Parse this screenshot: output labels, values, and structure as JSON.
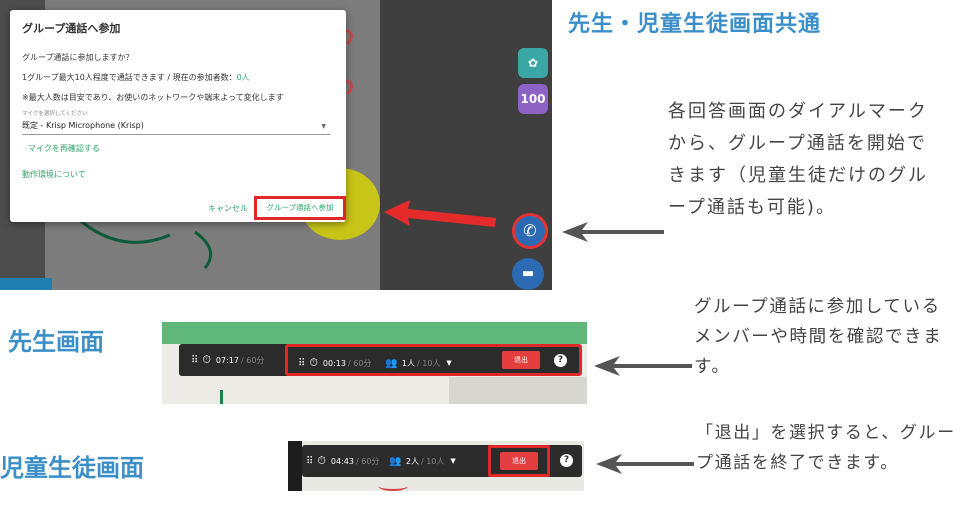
{
  "top": {
    "heading": "先生・児童生徒画面共通",
    "description": "各回答画面のダイアルマークから、グループ通話を開始できます（児童生徒だけのグループ通話も可能)。",
    "side_buttons": [
      {
        "icon": "group-call-icon",
        "label": "",
        "color": "#3aa7a4"
      },
      {
        "icon": "percent-100-icon",
        "label": "100",
        "color": "#8d62c4"
      }
    ],
    "call_fab_icon": "phone-icon",
    "chat_fab_icon": "chat-icon",
    "dialog": {
      "title": "グループ通話へ参加",
      "question": "グループ通話に参加しますか？",
      "limit_prefix": "1グループ最大10人程度で通話できます / 現在の参加者数：",
      "current_count": "0人",
      "note": "※最大人数は目安であり、お使いのネットワークや端末よって変化します",
      "mic_label": "マイクを選択してください",
      "mic_value": "既定 - Krisp Microphone (Krisp)",
      "recheck_link": "マイクを再確認する",
      "env_link": "動作環境について",
      "cancel": "キャンセル",
      "join": "グループ通話へ参加"
    }
  },
  "teacher": {
    "label": "先生画面",
    "description": "グループ通話に参加しているメンバーや時間を確認できます。",
    "timer": {
      "elapsed": "07:17",
      "limit": "/ 60分"
    },
    "call": {
      "elapsed": "00:13",
      "limit": "/ 60分",
      "members": "1人",
      "max": "/ 10人",
      "leave": "退出",
      "help": "?"
    }
  },
  "student": {
    "label": "児童生徒画面",
    "description": "「退出」を選択すると、グループ通話を終了できます。",
    "call": {
      "elapsed": "04:43",
      "limit": "/ 60分",
      "members": "2人",
      "max": "/ 10人",
      "leave": "退出",
      "help": "?"
    }
  },
  "colors": {
    "accent_blue": "#3b8fc8",
    "highlight_red": "#e02828",
    "green_link": "#2ea86a"
  }
}
